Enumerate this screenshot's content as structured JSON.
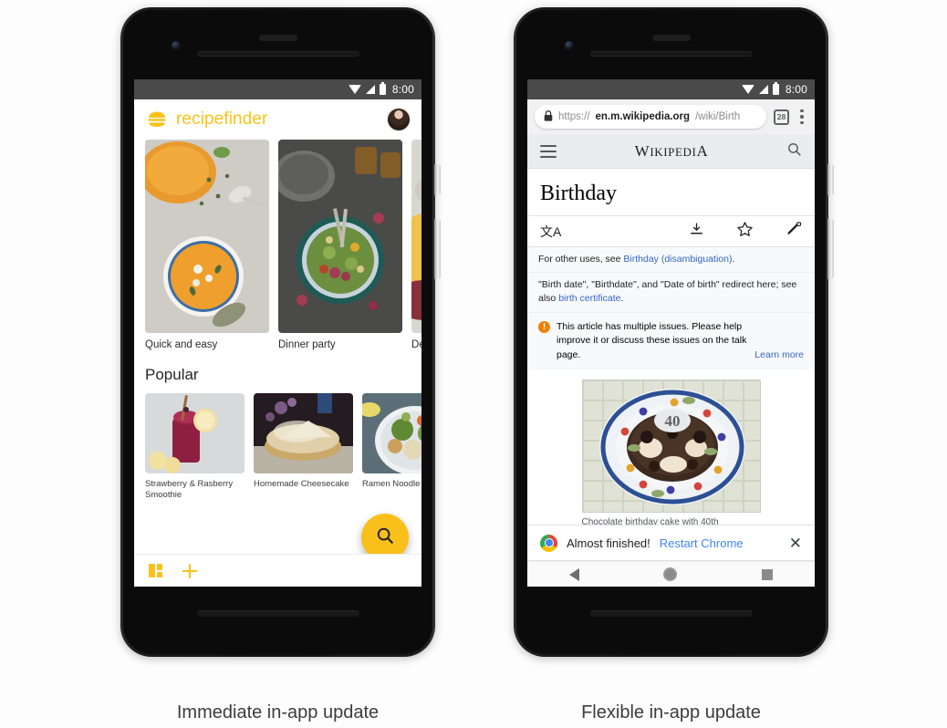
{
  "page": {
    "background": "#fdfdfd",
    "captions": [
      {
        "text": "Immediate in-app update"
      },
      {
        "text": "Flexible in-app update"
      }
    ]
  },
  "phone_left": {
    "status_bar": {
      "time": "8:00",
      "icons": [
        "wifi-icon",
        "signal-icon",
        "battery-icon"
      ]
    },
    "app": {
      "name": "recipefinder",
      "logo_icon": "burger-icon",
      "avatar_icon": "user-avatar",
      "featured": [
        {
          "title": "Quick and easy"
        },
        {
          "title": "Dinner party"
        },
        {
          "title": "De"
        }
      ],
      "section_title": "Popular",
      "popular": [
        {
          "title": "Strawberry & Rasberry Smoothie"
        },
        {
          "title": "Homemade Cheesecake"
        },
        {
          "title": "Ramen Noodle Bo"
        }
      ],
      "fab_icon": "search-icon",
      "bottom_nav": [
        {
          "icon": "grid-icon"
        },
        {
          "icon": "plus-icon"
        }
      ],
      "accent_color": "#fcc21b"
    }
  },
  "phone_right": {
    "status_bar": {
      "time": "8:00",
      "icons": [
        "wifi-icon",
        "signal-icon",
        "battery-icon"
      ]
    },
    "browser": {
      "lock_icon": "lock-icon",
      "url_scheme": "https://",
      "url_domain": "en.m.wikipedia.org",
      "url_path": "/wiki/Birth",
      "tab_count": "28",
      "menu_icon": "kebab-menu-icon"
    },
    "wikipedia": {
      "menu_icon": "hamburger-icon",
      "wordmark_lead": "W",
      "wordmark_rest": "IKIPEDI",
      "wordmark_tail": "A",
      "search_icon": "search-icon",
      "article_title": "Birthday",
      "tools": [
        {
          "icon": "language-icon",
          "label": "文A"
        },
        {
          "icon": "download-icon"
        },
        {
          "icon": "star-icon"
        },
        {
          "icon": "edit-locked-icon"
        }
      ],
      "hatnote_1_prefix": "For other uses, see ",
      "hatnote_1_link": "Birthday (disambiguation)",
      "hatnote_1_suffix": ".",
      "hatnote_2_text": "\"Birth date\", \"Birthdate\", and \"Date of birth\" redirect here; see also",
      "hatnote_2_link": "birth certificate",
      "hatnote_2_suffix": ".",
      "issue_icon": "warning-icon",
      "issue_mark": "!",
      "issue_text": "This article has multiple issues. Please help improve it or discuss these issues on the talk page.",
      "issue_link": "Learn more",
      "thumb_caption": "Chocolate birthday cake with 40th",
      "cake_number": "40"
    },
    "snackbar": {
      "icon": "chrome-icon",
      "message": "Almost finished!",
      "action": "Restart Chrome",
      "close_icon": "close-icon",
      "close_glyph": "✕",
      "link_color": "#4285f4"
    },
    "nav_bar": [
      {
        "icon": "back-icon"
      },
      {
        "icon": "home-icon"
      },
      {
        "icon": "recents-icon"
      }
    ]
  }
}
